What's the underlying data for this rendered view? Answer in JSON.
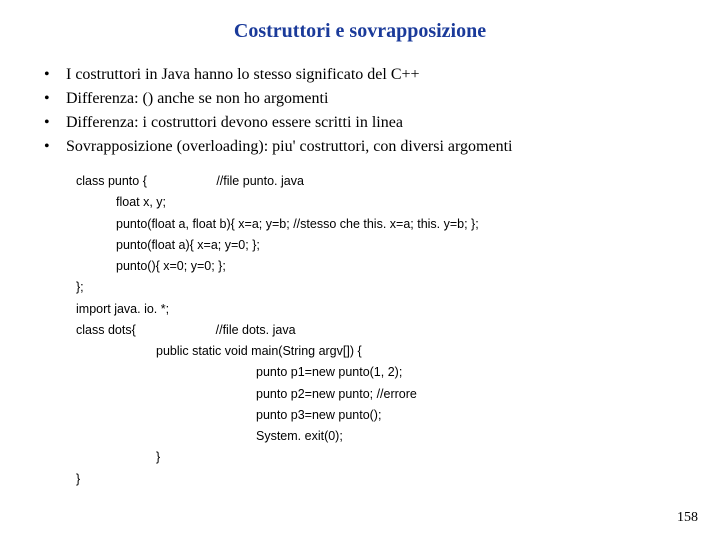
{
  "title": "Costruttori e sovrapposizione",
  "bullets": [
    "I costruttori in Java hanno lo stesso significato del C++",
    "Differenza: () anche se non ho argomenti",
    "Differenza: i costruttori devono essere scritti in linea",
    "Sovrapposizione (overloading): piu' costruttori, con diversi argomenti"
  ],
  "code": {
    "l0": "class punto {                    //file punto. java",
    "l1": "float x, y;",
    "l2": "punto(float a, float b){ x=a; y=b; //stesso che this. x=a; this. y=b; };",
    "l3": "punto(float a){ x=a; y=0; };",
    "l4": "punto(){ x=0; y=0; };",
    "l5": "};",
    "l6": "import java. io. *;",
    "l7": "class dots{                       //file dots. java",
    "l8": "public static void main(String argv[]) {",
    "l9": "punto p1=new punto(1, 2);",
    "l10": "punto p2=new punto; //errore",
    "l11": "punto p3=new punto();",
    "l12": "System. exit(0);",
    "l13": "}",
    "l14": "}"
  },
  "pageNumber": "158"
}
